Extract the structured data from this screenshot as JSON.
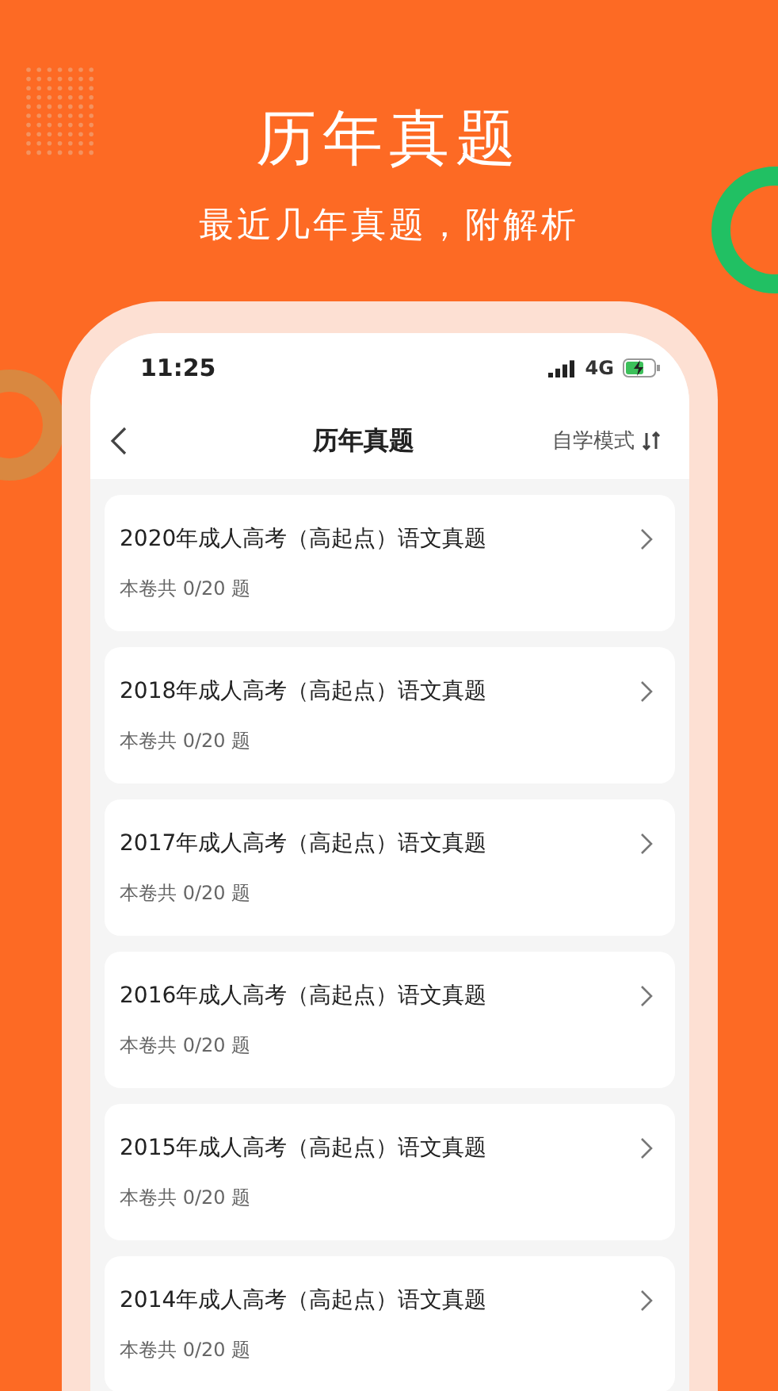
{
  "headline": "历年真题",
  "subheadline": "最近几年真题，附解析",
  "status_bar": {
    "time": "11:25",
    "network": "4G"
  },
  "nav": {
    "title": "历年真题",
    "mode": "自学模式"
  },
  "papers": [
    {
      "title": "2020年成人高考（高起点）语文真题",
      "summary": "本卷共 0/20 题"
    },
    {
      "title": "2018年成人高考（高起点）语文真题",
      "summary": "本卷共 0/20 题"
    },
    {
      "title": "2017年成人高考（高起点）语文真题",
      "summary": "本卷共 0/20 题"
    },
    {
      "title": "2016年成人高考（高起点）语文真题",
      "summary": "本卷共 0/20 题"
    },
    {
      "title": "2015年成人高考（高起点）语文真题",
      "summary": "本卷共 0/20 题"
    },
    {
      "title": "2014年成人高考（高起点）语文真题",
      "summary": "本卷共 0/20 题"
    }
  ]
}
